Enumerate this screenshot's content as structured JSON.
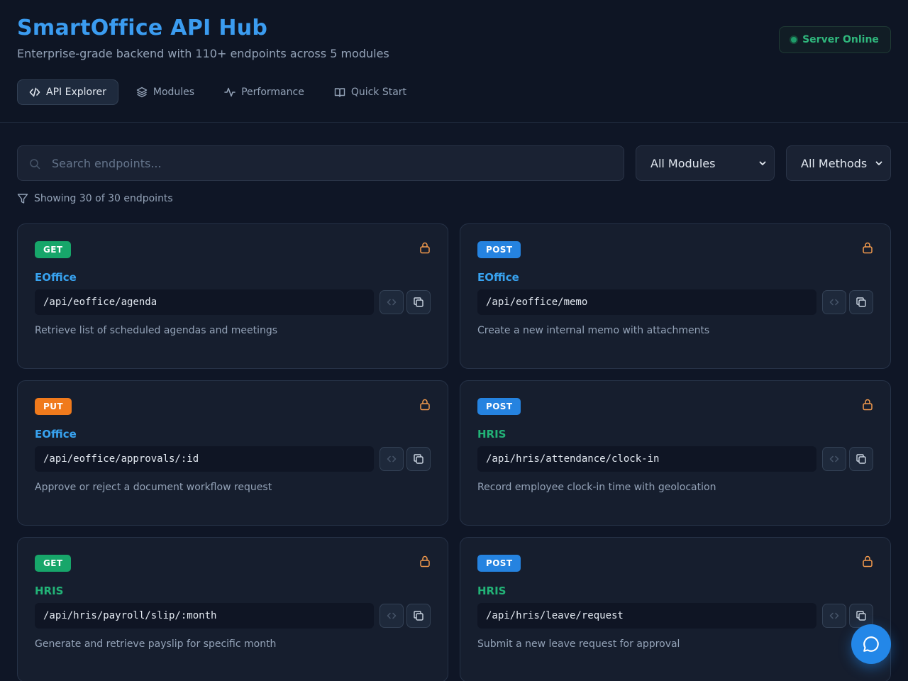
{
  "header": {
    "title": "SmartOffice API Hub",
    "subtitle": "Enterprise-grade backend with 110+ endpoints across 5 modules",
    "status": "Server Online"
  },
  "tabs": [
    {
      "label": "API Explorer",
      "icon": "code-icon",
      "active": true
    },
    {
      "label": "Modules",
      "icon": "layers-icon",
      "active": false
    },
    {
      "label": "Performance",
      "icon": "activity-icon",
      "active": false
    },
    {
      "label": "Quick Start",
      "icon": "book-icon",
      "active": false
    }
  ],
  "filters": {
    "search_placeholder": "Search endpoints...",
    "module_select": "All Modules",
    "method_select": "All Methods",
    "count_text": "Showing 30 of 30 endpoints"
  },
  "colors": {
    "GET": "#17a66a",
    "POST": "#2583e0",
    "PUT": "#f07a1c",
    "EOffice": "#38a3f0",
    "HRIS": "#22b377",
    "lock": "#f39a4d"
  },
  "endpoints": [
    {
      "method": "GET",
      "module": "EOffice",
      "path": "/api/eoffice/agenda",
      "description": "Retrieve list of scheduled agendas and meetings"
    },
    {
      "method": "POST",
      "module": "EOffice",
      "path": "/api/eoffice/memo",
      "description": "Create a new internal memo with attachments"
    },
    {
      "method": "PUT",
      "module": "EOffice",
      "path": "/api/eoffice/approvals/:id",
      "description": "Approve or reject a document workflow request"
    },
    {
      "method": "POST",
      "module": "HRIS",
      "path": "/api/hris/attendance/clock-in",
      "description": "Record employee clock-in time with geolocation"
    },
    {
      "method": "GET",
      "module": "HRIS",
      "path": "/api/hris/payroll/slip/:month",
      "description": "Generate and retrieve payslip for specific month"
    },
    {
      "method": "POST",
      "module": "HRIS",
      "path": "/api/hris/leave/request",
      "description": "Submit a new leave request for approval"
    }
  ]
}
